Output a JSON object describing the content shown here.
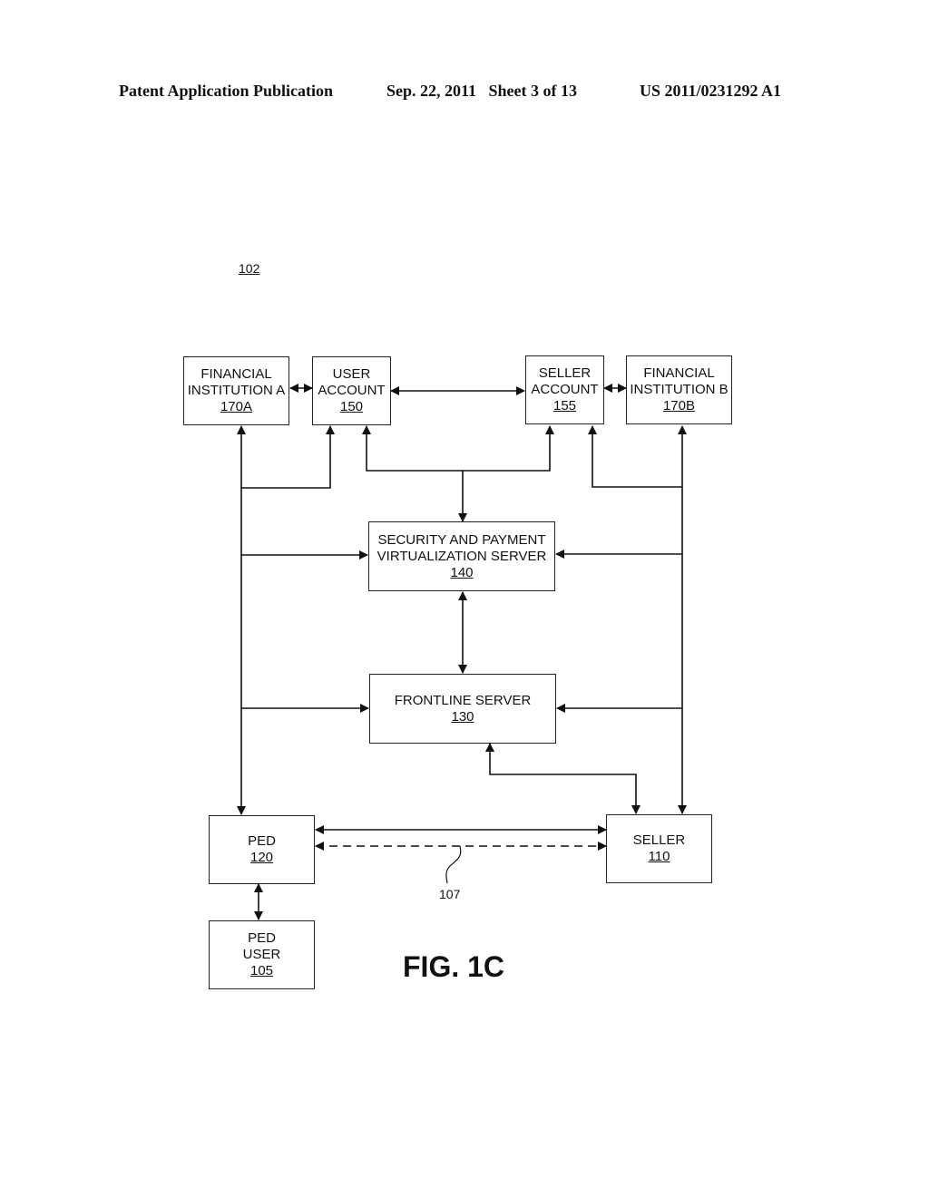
{
  "header": {
    "publication": "Patent Application Publication",
    "date_sheet": "Sep. 22, 2011   Sheet 3 of 13",
    "patent_number": "US 2011/0231292 A1"
  },
  "diagram_ref": "102",
  "figure_label": "FIG. 1C",
  "connection_label": "107",
  "nodes": {
    "fin_a": {
      "lines": [
        "FINANCIAL",
        "INSTITUTION A"
      ],
      "num": "170A"
    },
    "user_account": {
      "lines": [
        "USER",
        "ACCOUNT"
      ],
      "num": "150"
    },
    "seller_account": {
      "lines": [
        "SELLER",
        "ACCOUNT"
      ],
      "num": "155"
    },
    "fin_b": {
      "lines": [
        "FINANCIAL",
        "INSTITUTION B"
      ],
      "num": "170B"
    },
    "security_server": {
      "lines": [
        "SECURITY AND PAYMENT",
        "VIRTUALIZATION SERVER"
      ],
      "num": "140"
    },
    "frontline_server": {
      "lines": [
        "FRONTLINE SERVER"
      ],
      "num": "130"
    },
    "ped": {
      "lines": [
        "PED"
      ],
      "num": "120"
    },
    "seller": {
      "lines": [
        "SELLER"
      ],
      "num": "110"
    },
    "ped_user": {
      "lines": [
        "PED",
        "USER"
      ],
      "num": "105"
    }
  },
  "edges": [
    {
      "from": "fin_a",
      "to": "user_account",
      "type": "bidirectional"
    },
    {
      "from": "user_account",
      "to": "seller_account",
      "type": "bidirectional"
    },
    {
      "from": "seller_account",
      "to": "fin_b",
      "type": "bidirectional"
    },
    {
      "from": "security_server",
      "to": "user_account",
      "type": "directed"
    },
    {
      "from": "security_server",
      "to": "seller_account",
      "type": "directed"
    },
    {
      "from": "fin_a_bus",
      "to": "user_account",
      "type": "directed"
    },
    {
      "from": "fin_b_bus",
      "to": "seller_account",
      "type": "directed"
    },
    {
      "from": "fin_a_bus",
      "to": "security_server",
      "type": "directed"
    },
    {
      "from": "fin_b_bus",
      "to": "security_server",
      "type": "directed"
    },
    {
      "from": "fin_a_bus",
      "to": "frontline_server",
      "type": "directed"
    },
    {
      "from": "fin_b_bus",
      "to": "frontline_server",
      "type": "directed"
    },
    {
      "from": "security_server",
      "to": "frontline_server",
      "type": "bidirectional"
    },
    {
      "from": "fin_a",
      "to": "ped",
      "type": "bidirectional"
    },
    {
      "from": "fin_b",
      "to": "seller",
      "type": "bidirectional"
    },
    {
      "from": "frontline_server",
      "to": "seller",
      "type": "bidirectional"
    },
    {
      "from": "ped",
      "to": "seller",
      "type": "bidirectional"
    },
    {
      "from": "ped",
      "to": "seller",
      "type": "bidirectional-dashed",
      "label": "107"
    },
    {
      "from": "ped",
      "to": "ped_user",
      "type": "bidirectional"
    }
  ]
}
